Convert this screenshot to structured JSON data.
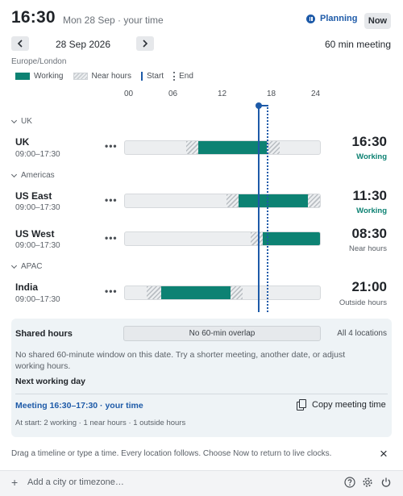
{
  "header": {
    "time": "16:30",
    "date_sub": "Mon 28 Sep · your time",
    "mode_label": "Planning",
    "now_label": "Now"
  },
  "nav": {
    "prev_icon": "chevron-left-icon",
    "next_icon": "chevron-right-icon",
    "date": "28 Sep 2026",
    "meeting_length": "60 min meeting"
  },
  "timezone": "Europe/London",
  "legend": {
    "working": "Working",
    "near_hours": "Near hours",
    "start": "Start",
    "end": "End"
  },
  "axis": {
    "ticks": [
      "00",
      "06",
      "12",
      "18",
      "24"
    ]
  },
  "colors": {
    "working": "#0d8273",
    "accent": "#1d5aa8",
    "near": "#b9bec3"
  },
  "groups": [
    {
      "name": "UK"
    },
    {
      "name": "Americas"
    },
    {
      "name": "APAC"
    }
  ],
  "locations": [
    {
      "name": "UK",
      "hours": "09:00–17:30",
      "time": "16:30",
      "status": "Working",
      "status_kind": "working",
      "segments": [
        {
          "kind": "near",
          "start": 7.5,
          "end": 9
        },
        {
          "kind": "work",
          "start": 9,
          "end": 17.5
        },
        {
          "kind": "near",
          "start": 17.5,
          "end": 19
        }
      ]
    },
    {
      "name": "US East",
      "hours": "09:00–17:30",
      "time": "11:30",
      "status": "Working",
      "status_kind": "working",
      "segments": [
        {
          "kind": "near",
          "start": 12.5,
          "end": 14
        },
        {
          "kind": "work",
          "start": 14,
          "end": 22.5
        },
        {
          "kind": "near",
          "start": 22.5,
          "end": 24
        }
      ]
    },
    {
      "name": "US West",
      "hours": "09:00–17:30",
      "time": "08:30",
      "status": "Near hours",
      "status_kind": "other",
      "segments": [
        {
          "kind": "near",
          "start": 15.5,
          "end": 17
        },
        {
          "kind": "work",
          "start": 17,
          "end": 24
        }
      ]
    },
    {
      "name": "India",
      "hours": "09:00–17:30",
      "time": "21:00",
      "status": "Outside hours",
      "status_kind": "other",
      "segments": [
        {
          "kind": "near",
          "start": 2.7,
          "end": 4.5
        },
        {
          "kind": "work",
          "start": 4.5,
          "end": 13
        },
        {
          "kind": "near",
          "start": 13,
          "end": 14.5
        }
      ]
    }
  ],
  "meeting_marker": {
    "start_hour": 16.5,
    "end_hour": 17.5
  },
  "shared": {
    "title": "Shared hours",
    "overlap": "No 60-min overlap",
    "all_locations": "All 4 locations",
    "note": "No shared 60-minute window on this date. Try a shorter meeting, another date, or adjust working hours.",
    "next_working_day": "Next working day",
    "meeting": "Meeting 16:30–17:30 · your time",
    "copy_label": "Copy meeting time",
    "at_start": "At start: 2 working · 1 near hours · 1 outside hours"
  },
  "hint": "Drag a timeline or type a time. Every location follows. Choose Now to return to live clocks.",
  "footer": {
    "add_placeholder": "Add a city or timezone…",
    "icons": [
      "help-icon",
      "settings-icon",
      "power-icon"
    ]
  }
}
